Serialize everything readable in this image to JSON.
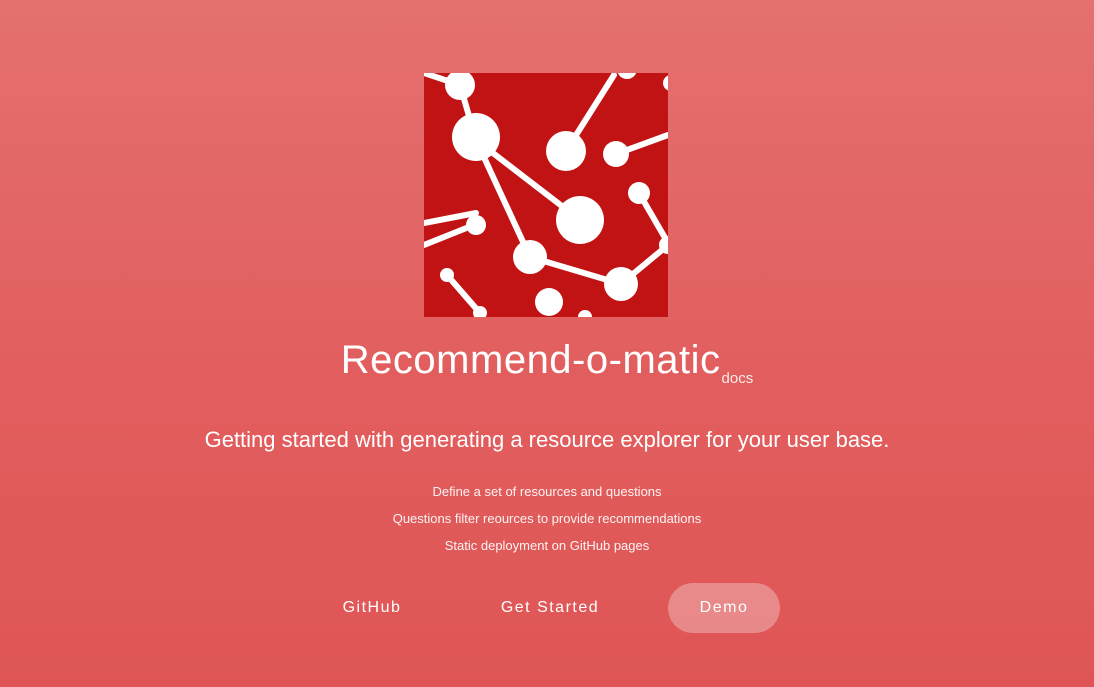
{
  "header": {
    "title": "Recommend-o-matic",
    "suffix": "docs"
  },
  "tagline": "Getting started with generating a resource explorer for your user base.",
  "features": [
    "Define a set of resources and questions",
    "Questions filter reources to provide recommendations",
    "Static deployment on GitHub pages"
  ],
  "buttons": {
    "github": "GitHub",
    "get_started": "Get Started",
    "demo": "Demo"
  },
  "logo": {
    "icon": "network-graph-icon",
    "background_color": "#c11313",
    "node_color": "#ffffff"
  },
  "colors": {
    "page_gradient_top": "#e47070",
    "page_gradient_bottom": "#df5555",
    "demo_button_fill": "rgba(255,255,255,0.3)"
  }
}
